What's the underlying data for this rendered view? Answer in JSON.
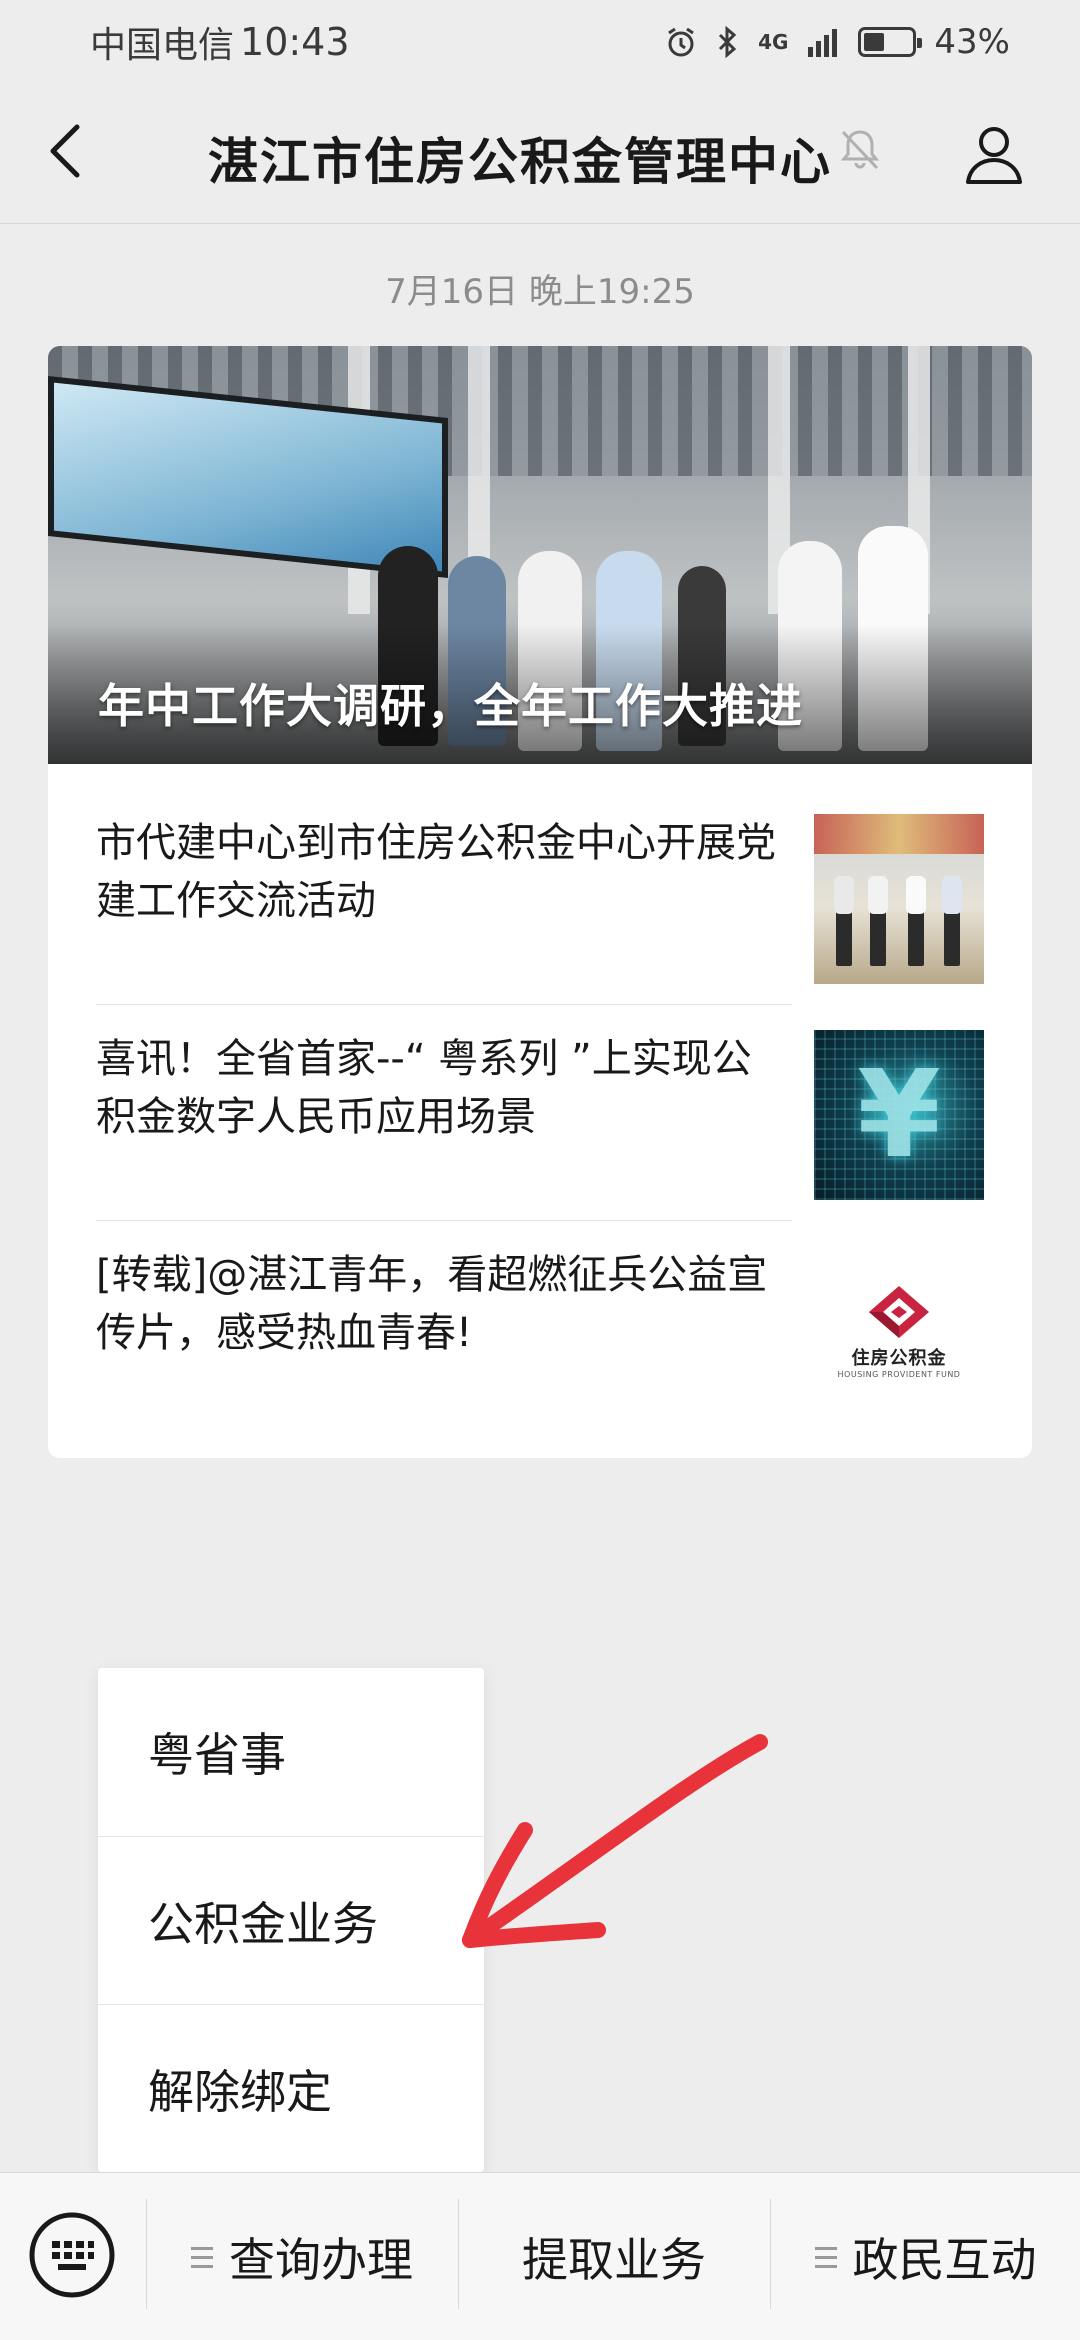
{
  "status_bar": {
    "carrier": "中国电信",
    "time": "10:43",
    "network": "4G",
    "battery_percent": "43%",
    "battery_level": 0.43
  },
  "header": {
    "title": "湛江市住房公积金管理中心"
  },
  "chat": {
    "date_stamp": "7月16日 晚上19:25"
  },
  "article_card": {
    "hero_title": "年中工作大调研，全年工作大推进",
    "articles": [
      {
        "title": "市代建中心到市住房公积金中心开展党建工作交流活动"
      },
      {
        "title": "喜讯！全省首家--“ 粤系列 ”上实现公积金数字人民币应用场景"
      },
      {
        "title": "[转载]@湛江青年，看超燃征兵公益宣传片，感受热血青春!"
      }
    ],
    "logo": {
      "name": "住房公积金",
      "sub": "HOUSING PROVIDENT FUND"
    }
  },
  "popup_menu": {
    "items": [
      {
        "label": "粤省事"
      },
      {
        "label": "公积金业务"
      },
      {
        "label": "解除绑定"
      }
    ]
  },
  "bottom_menu": {
    "items": [
      {
        "label": "查询办理",
        "has_submenu": true
      },
      {
        "label": "提取业务",
        "has_submenu": false
      },
      {
        "label": "政民互动",
        "has_submenu": true
      }
    ]
  },
  "colors": {
    "background": "#ededed",
    "card": "#ffffff",
    "annotation_red": "#e8333a",
    "brand_logo": "#c8233f"
  }
}
